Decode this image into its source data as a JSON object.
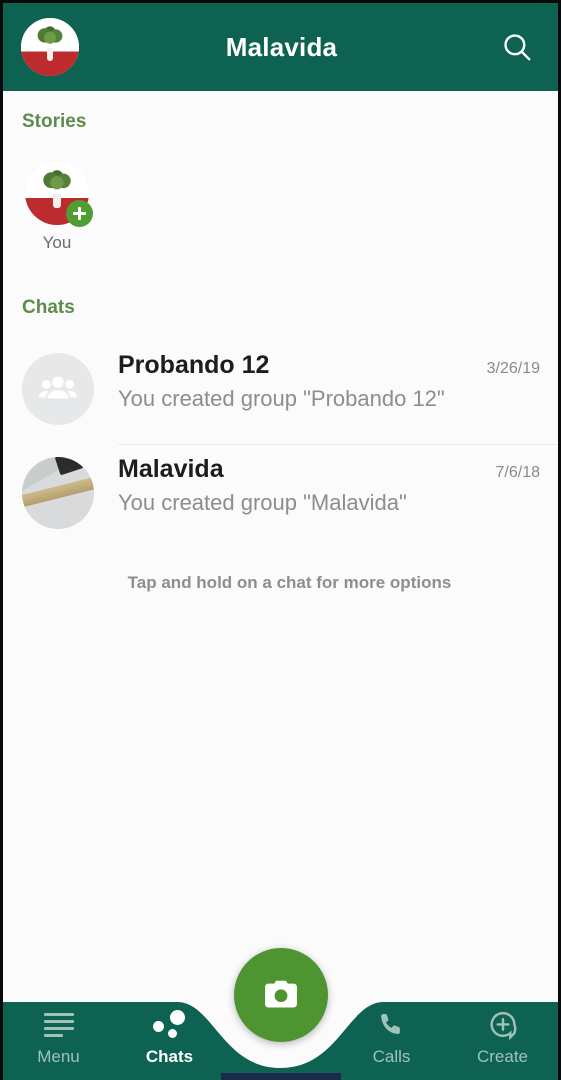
{
  "header": {
    "title": "Malavida",
    "avatar_name": "profile-avatar",
    "search_icon": "search-icon"
  },
  "stories": {
    "section_title": "Stories",
    "items": [
      {
        "label": "You",
        "badge_icon": "plus-icon"
      }
    ]
  },
  "chats": {
    "section_title": "Chats",
    "hint": "Tap and hold on a chat for more options",
    "rows": [
      {
        "name": "Probando 12",
        "date": "3/26/19",
        "preview": "You created group \"Probando 12\"",
        "avatar_type": "group-icon"
      },
      {
        "name": "Malavida",
        "date": "7/6/18",
        "preview": "You created group \"Malavida\"",
        "avatar_type": "photo"
      }
    ]
  },
  "fab": {
    "icon": "camera-icon"
  },
  "bottom_nav": {
    "items": [
      {
        "label": "Menu",
        "icon": "hamburger-icon",
        "active": false
      },
      {
        "label": "Chats",
        "icon": "chat-dots-icon",
        "active": true
      },
      {
        "label": "Calls",
        "icon": "phone-icon",
        "active": false
      },
      {
        "label": "Create",
        "icon": "plus-bubble-icon",
        "active": false
      }
    ]
  },
  "colors": {
    "header_teal": "#0d6252",
    "accent_green": "#5f8c4c",
    "fab_green": "#4e9431",
    "badge_green": "#4e9e33",
    "nav_inactive": "#9fc2b9",
    "page_bg": "#fbfbfb"
  }
}
